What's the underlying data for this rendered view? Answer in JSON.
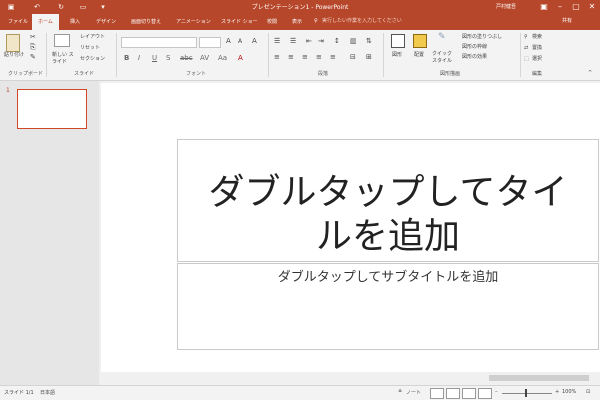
{
  "title_bar": {
    "title": "プレゼンテーション1 - PowerPoint",
    "user": "戸村健吾",
    "quick_access": [
      "save-icon",
      "undo-icon",
      "redo-icon",
      "start-from-beginning-icon",
      "customize-icon"
    ]
  },
  "tabs": {
    "file": "ファイル",
    "home": "ホーム",
    "insert": "挿入",
    "design": "デザイン",
    "transitions": "画面切り替え",
    "animations": "アニメーション",
    "slideshow": "スライド ショー",
    "review": "校閲",
    "view": "表示",
    "tell_me": "実行したい作業を入力してください",
    "share": "共有"
  },
  "ribbon": {
    "clipboard": {
      "paste": "貼り付け",
      "label": "クリップボード"
    },
    "slides": {
      "new_slide": "新しい スライド",
      "layout": "レイアウト",
      "reset": "リセット",
      "section": "セクション",
      "label": "スライド"
    },
    "font": {
      "label": "フォント"
    },
    "paragraph": {
      "label": "段落"
    },
    "drawing": {
      "shapes": "図形",
      "arrange": "配置",
      "quick_styles": "クイック スタイル",
      "fill": "図形の塗りつぶし",
      "outline": "図形の枠線",
      "effects": "図形の効果",
      "label": "図形描画"
    },
    "editing": {
      "find": "検索",
      "replace": "置換",
      "select": "選択",
      "label": "編集"
    }
  },
  "slide_pane": {
    "number": "1"
  },
  "slide": {
    "title_line1": "ダブルタップしてタイ",
    "title_line2": "ルを追加",
    "subtitle": "ダブルタップしてサブタイトルを追加"
  },
  "status_bar": {
    "slide_counter": "スライド 1/1",
    "language": "日本語",
    "notes": "ノート",
    "zoom": "100%"
  },
  "colors": {
    "accent": "#b7472a",
    "thumb_border": "#d24726"
  }
}
